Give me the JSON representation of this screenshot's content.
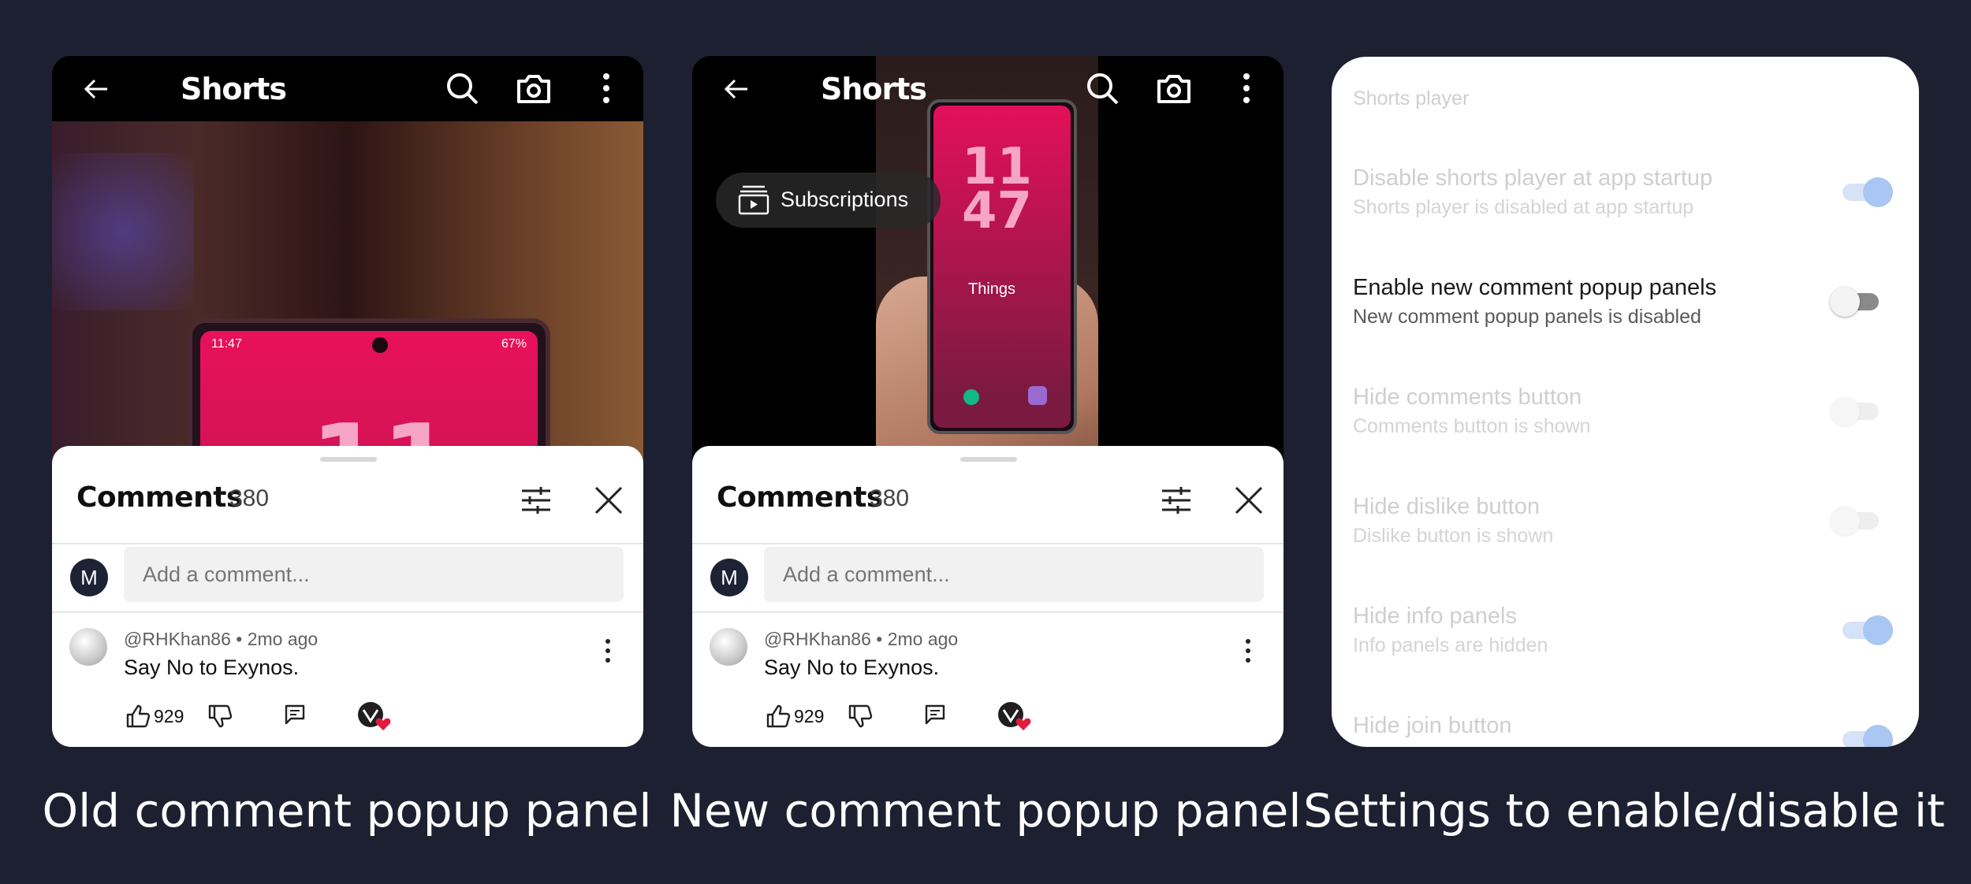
{
  "panels": [
    {
      "appbar_title": "Shorts",
      "comments": {
        "title": "Comments",
        "count": "380",
        "avatar_letter": "M",
        "add_placeholder": "Add a comment...",
        "comment": {
          "meta": "@RHKhan86 • 2mo ago",
          "text": "Say No to Exynos.",
          "likes": "929"
        }
      },
      "video": {
        "clock": "11",
        "status_time": "11:47",
        "status_right": "67%"
      }
    },
    {
      "appbar_title": "Shorts",
      "chip_label": "Subscriptions",
      "comments": {
        "title": "Comments",
        "count": "380",
        "avatar_letter": "M",
        "add_placeholder": "Add a comment...",
        "comment": {
          "meta": "@RHKhan86 • 2mo ago",
          "text": "Say No to Exynos.",
          "likes": "929"
        }
      },
      "video": {
        "clock": "11 47",
        "things": "Things"
      }
    }
  ],
  "settings": {
    "section": "Shorts player",
    "rows": [
      {
        "title": "Disable shorts player at app startup",
        "summary": "Shorts player is disabled at app startup",
        "on": true,
        "active": false
      },
      {
        "title": "Enable new comment popup panels",
        "summary": "New comment popup panels is disabled",
        "on": false,
        "active": true
      },
      {
        "title": "Hide comments button",
        "summary": "Comments button is shown",
        "on": false,
        "active": false
      },
      {
        "title": "Hide dislike button",
        "summary": "Dislike button is shown",
        "on": false,
        "active": false
      },
      {
        "title": "Hide info panels",
        "summary": "Info panels are hidden",
        "on": true,
        "active": false
      },
      {
        "title": "Hide join button",
        "summary": "",
        "on": true,
        "active": false
      }
    ]
  },
  "captions": [
    "Old comment popup panel",
    "New comment popup panel",
    "Settings to enable/disable it"
  ],
  "colors": {
    "background": "#1c2030",
    "accent": "#aac6f2"
  }
}
